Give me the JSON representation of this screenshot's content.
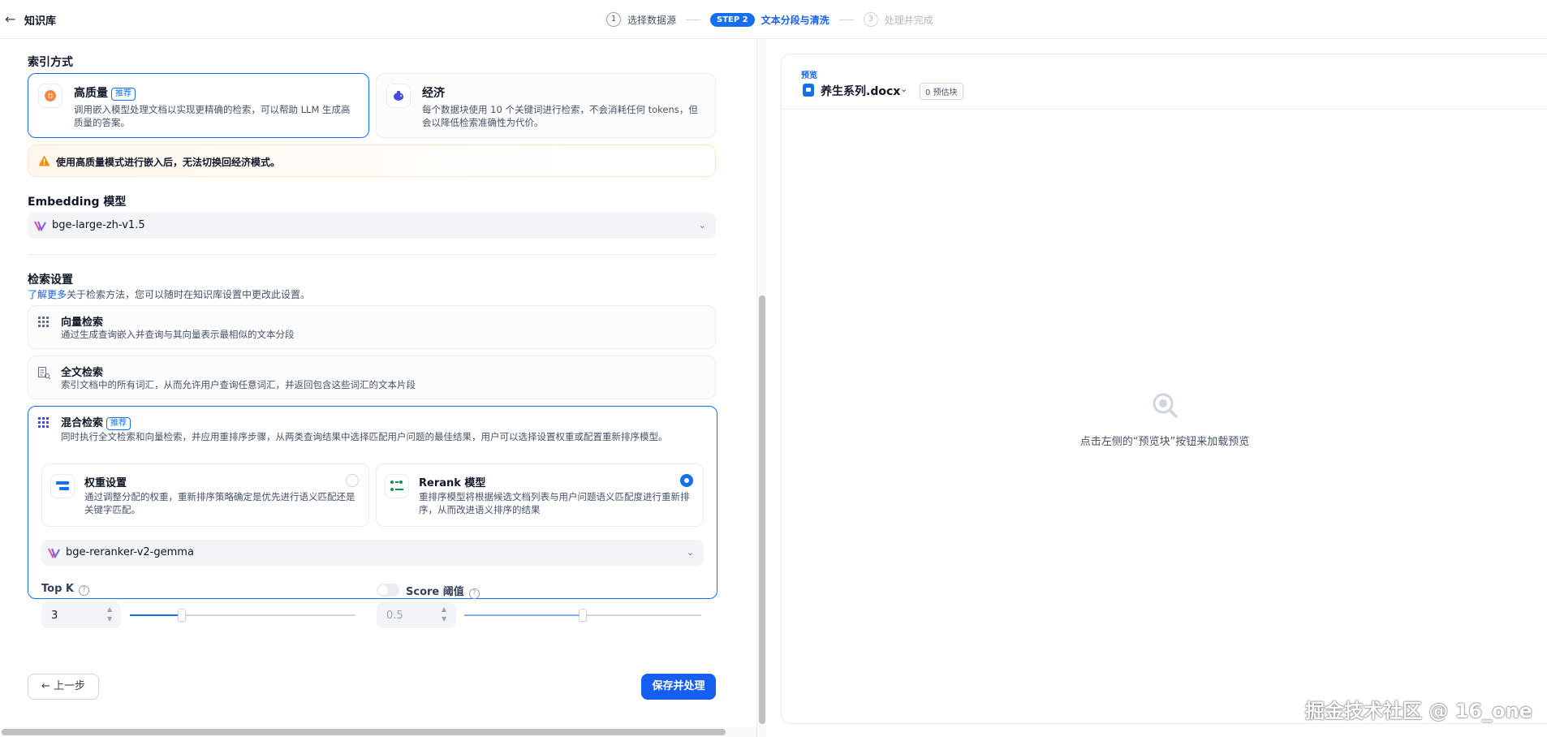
{
  "header": {
    "title": "知识库",
    "steps": [
      {
        "num": "1",
        "label": "选择数据源"
      },
      {
        "num": "STEP 2",
        "label": "文本分段与清洗"
      },
      {
        "num": "3",
        "label": "处理并完成"
      }
    ]
  },
  "index": {
    "title": "索引方式",
    "high_quality": {
      "title": "高质量",
      "badge": "推荐",
      "desc": "调用嵌入模型处理文档以实现更精确的检索，可以帮助 LLM 生成高质量的答案。"
    },
    "economy": {
      "title": "经济",
      "desc": "每个数据块使用 10 个关键词进行检索，不会消耗任何 tokens，但会以降低检索准确性为代价。"
    },
    "warning": "使用高质量模式进行嵌入后，无法切换回经济模式。"
  },
  "embedding": {
    "title": "Embedding 模型",
    "value": "bge-large-zh-v1.5"
  },
  "retrieval": {
    "title": "检索设置",
    "learn_more": "了解更多",
    "learn_rest": "关于检索方法，您可以随时在知识库设置中更改此设置。",
    "vector": {
      "title": "向量检索",
      "desc": "通过生成查询嵌入并查询与其向量表示最相似的文本分段"
    },
    "fulltext": {
      "title": "全文检索",
      "desc": "索引文档中的所有词汇，从而允许用户查询任意词汇，并返回包含这些词汇的文本片段"
    },
    "hybrid": {
      "title": "混合检索",
      "badge": "推荐",
      "desc": "同时执行全文检索和向量检索，并应用重排序步骤，从两类查询结果中选择匹配用户问题的最佳结果，用户可以选择设置权重或配置重新排序模型。"
    },
    "weight": {
      "title": "权重设置",
      "desc": "通过调整分配的权重，重新排序策略确定是优先进行语义匹配还是关键字匹配。"
    },
    "rerank": {
      "title": "Rerank 模型",
      "desc": "重排序模型将根据候选文档列表与用户问题语义匹配度进行重新排序，从而改进语义排序的结果"
    },
    "rerank_model": "bge-reranker-v2-gemma",
    "top_k": {
      "label": "Top K",
      "value": "3",
      "fraction": 0.23
    },
    "score": {
      "label": "Score 阈值",
      "value": "0.5",
      "fraction": 0.5,
      "enabled": false
    }
  },
  "footer": {
    "prev": "上一步",
    "save": "保存并处理"
  },
  "preview": {
    "label": "预览",
    "doc_name": "养生系列.docx",
    "estimate": "0 预估块",
    "empty_text": "点击左侧的“预览块”按钮来加载预览"
  },
  "watermark": "掘金技术社区 @ 16_one",
  "colors": {
    "accent": "#155eef",
    "warning": "#f79009"
  }
}
